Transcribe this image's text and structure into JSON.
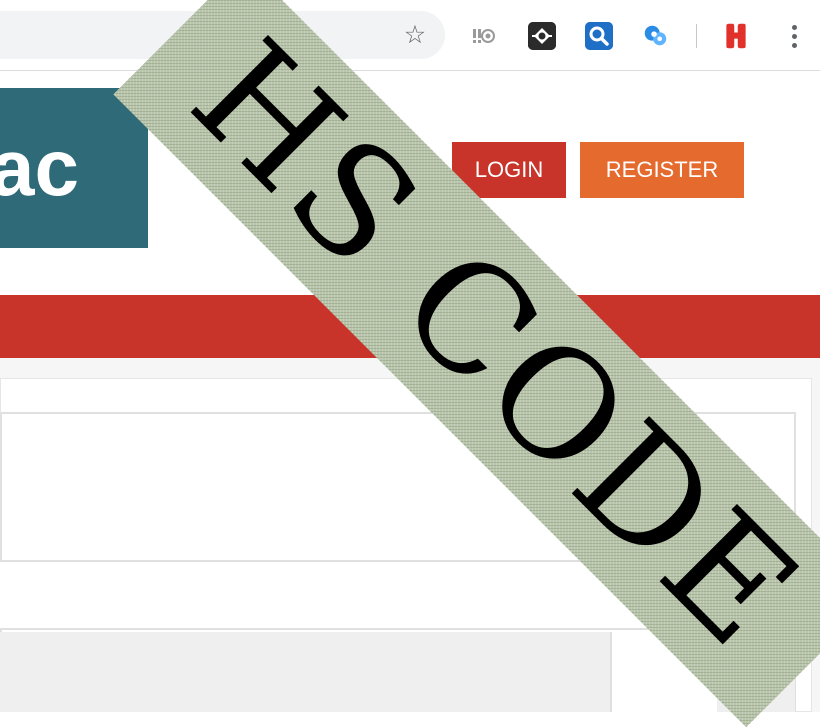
{
  "browser": {
    "toolbar_icons": [
      "star-icon",
      "extension-icon-exclaim",
      "extension-icon-dark",
      "extension-icon-search",
      "extension-icon-blue",
      "extension-icon-h",
      "menu-dots-icon"
    ],
    "colors": {
      "toolbar_bg": "#ffffff",
      "omnibox_bg": "#f1f3f4"
    }
  },
  "header": {
    "logo_text": "ac",
    "login_label": "LOGIN",
    "register_label": "REGISTER"
  },
  "watermark": {
    "text": "HS CODE"
  },
  "colors": {
    "brand_teal": "#2e6a78",
    "login_red": "#c8332a",
    "register_orange": "#e56a2e",
    "nav_bar_red": "#c8332a"
  }
}
